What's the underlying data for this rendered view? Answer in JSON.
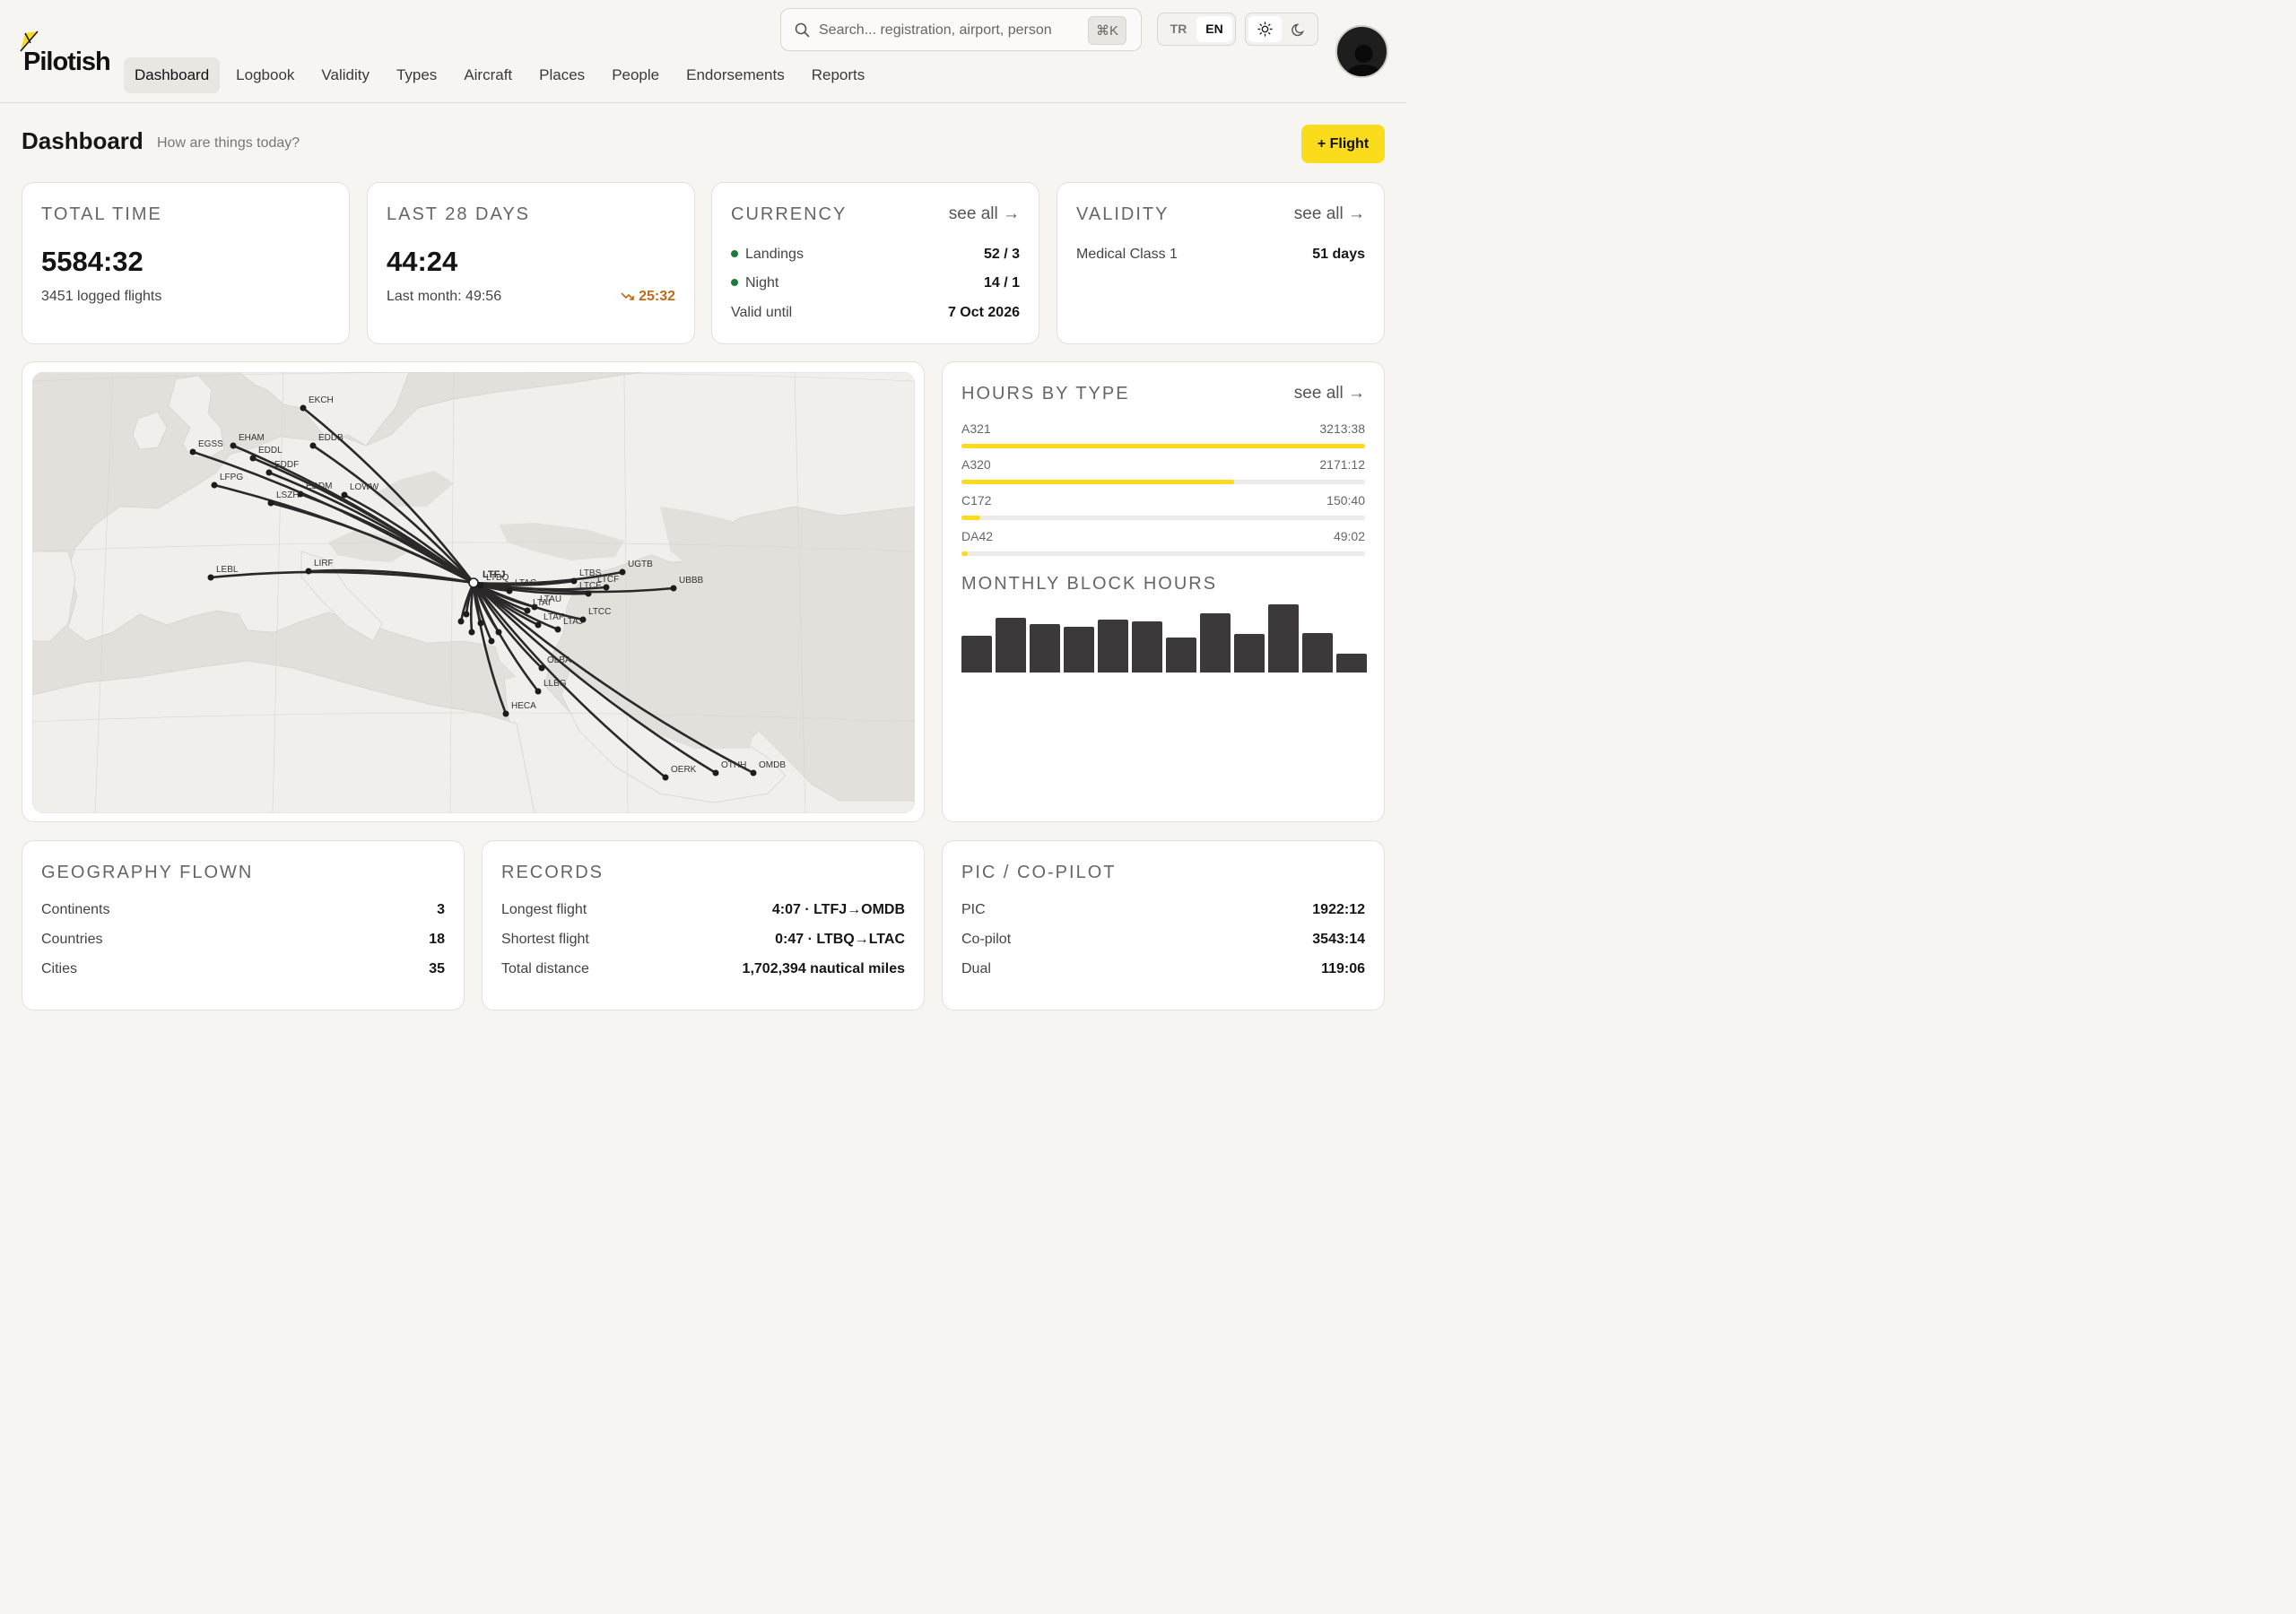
{
  "app": {
    "name": "Pilotish"
  },
  "nav": {
    "items": [
      "Dashboard",
      "Logbook",
      "Validity",
      "Types",
      "Aircraft",
      "Places",
      "People",
      "Endorsements",
      "Reports"
    ],
    "active": "Dashboard"
  },
  "search": {
    "placeholder": "Search... registration, airport, person",
    "shortcut": "⌘K"
  },
  "language": {
    "options": [
      "TR",
      "EN"
    ],
    "selected": "EN"
  },
  "theme": {
    "options": [
      "sun-icon",
      "moon-icon"
    ],
    "selected": "sun-icon"
  },
  "page": {
    "title": "Dashboard",
    "subtitle": "How are things today?",
    "add_flight_label": "+ Flight"
  },
  "cards": {
    "total_time": {
      "label": "TOTAL TIME",
      "value": "5584:32",
      "sub": "3451 logged flights"
    },
    "last_28": {
      "label": "LAST 28 DAYS",
      "value": "44:24",
      "sub": "Last month: 49:56",
      "trend": "25:32",
      "trend_color": "#c06a16"
    },
    "currency": {
      "label": "CURRENCY",
      "see_all": "see all",
      "rows": [
        {
          "label": "Landings",
          "value": "52 / 3",
          "dot": true
        },
        {
          "label": "Night",
          "value": "14 / 1",
          "dot": true
        },
        {
          "label": "Valid until",
          "value": "7 Oct 2026",
          "dot": false
        }
      ],
      "status_color": "#1f7a3d"
    },
    "validity": {
      "label": "VALIDITY",
      "see_all": "see all",
      "rows": [
        {
          "label": "Medical Class 1",
          "value": "51 days"
        }
      ]
    }
  },
  "map": {
    "hub": "LTFJ",
    "airports": [
      "EKCH",
      "EGSS",
      "EHAM",
      "EDDB",
      "EDDL",
      "EDDF",
      "LFPG",
      "EDDM",
      "LOWW",
      "LSZH",
      "LEBL",
      "LIRF",
      "LTFJ",
      "LTBQ",
      "LTAC",
      "LTBS",
      "LTCF",
      "LTCE",
      "UGTB",
      "UBBB",
      "LTAU",
      "LTAI",
      "LTAF",
      "LTAJ",
      "LTCC",
      "OLBA",
      "LLBG",
      "HECA",
      "OERK",
      "OTHH",
      "OMDB",
      "LGAV",
      "LTBJ",
      "LTFE",
      "LTBR",
      "LTFM",
      "LTFH"
    ],
    "labels": {
      "EKCH": "EKCH",
      "EGSS": "EGSS",
      "EHAM": "EHAM",
      "EDDB": "EDDB",
      "EDDL": "EDDL",
      "EDDF": "EDDF",
      "LFPG": "LFPG",
      "EDDM": "EDDM",
      "LOWW": "LOWW",
      "LSZH": "LSZH",
      "LEBL": "LEBL",
      "LIRF": "LIRF",
      "LTFJ": "LTFJ",
      "LTBQ": "LTBQ",
      "LTAC": "LTAC",
      "LTBS": "LTBS",
      "LTCF": "LTCF",
      "LTCE": "LTCE",
      "UGTB": "UGTB",
      "UBBB": "UBBB",
      "LTAU": "LTAU",
      "LTAI": "LTAI",
      "LTAF": "LTAF",
      "LTAJ": "LTAJ",
      "LTCC": "LTCC",
      "OLBA": "OLBA",
      "LLBG": "LLBG",
      "HECA": "HECA",
      "OERK": "OERK",
      "OTHH": "OTHH",
      "OMDB": "OMDB"
    }
  },
  "hours_by_type": {
    "label": "HOURS BY TYPE",
    "see_all": "see all",
    "types": [
      {
        "name": "A321",
        "value": "3213:38",
        "fraction": 1.0
      },
      {
        "name": "A320",
        "value": "2171:12",
        "fraction": 0.676
      },
      {
        "name": "C172",
        "value": "150:40",
        "fraction": 0.047
      },
      {
        "name": "DA42",
        "value": "49:02",
        "fraction": 0.015
      }
    ],
    "accent": "#fbdc1d"
  },
  "monthly_block_hours": {
    "label": "MONTHLY BLOCK HOURS",
    "values": [
      46,
      68,
      60,
      57,
      66,
      64,
      44,
      74,
      48,
      85,
      49,
      23
    ],
    "bar_color": "#3b393a"
  },
  "geography": {
    "label": "GEOGRAPHY FLOWN",
    "rows": [
      {
        "label": "Continents",
        "value": "3"
      },
      {
        "label": "Countries",
        "value": "18"
      },
      {
        "label": "Cities",
        "value": "35"
      }
    ]
  },
  "records": {
    "label": "RECORDS",
    "rows": [
      {
        "label": "Longest flight",
        "value": "4:07 · LTFJ→OMDB"
      },
      {
        "label": "Shortest flight",
        "value": "0:47 · LTBQ→LTAC"
      },
      {
        "label": "Total distance",
        "value": "1,702,394 nautical miles"
      }
    ]
  },
  "pic_copilot": {
    "label": "PIC / CO-PILOT",
    "rows": [
      {
        "label": "PIC",
        "value": "1922:12"
      },
      {
        "label": "Co-pilot",
        "value": "3543:14"
      },
      {
        "label": "Dual",
        "value": "119:06"
      }
    ]
  }
}
